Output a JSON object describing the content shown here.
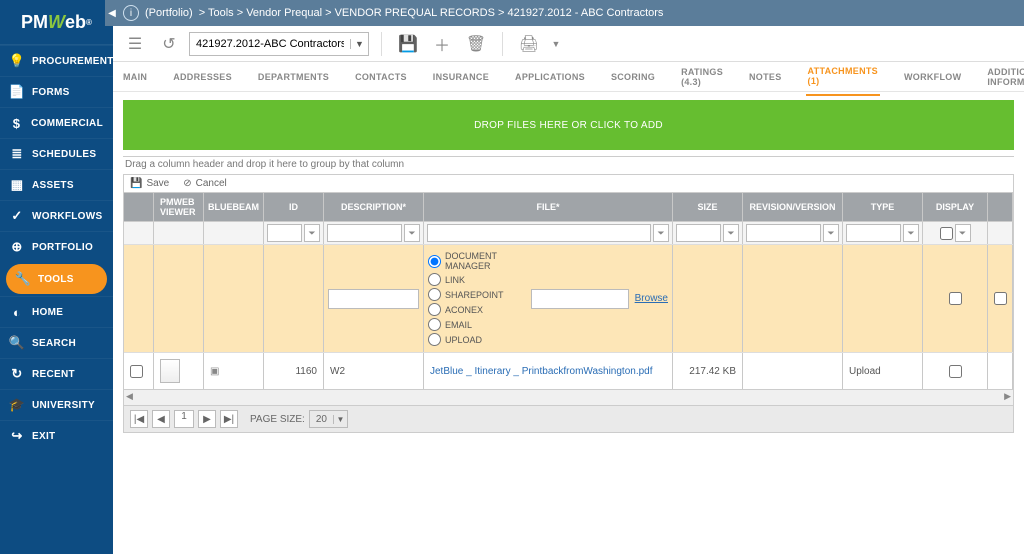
{
  "logo": {
    "pm": "PM",
    "w": "W",
    "eb": "eb",
    "reg": "®"
  },
  "sidebar": [
    {
      "icon": "💡",
      "label": "PROCUREMENT"
    },
    {
      "icon": "📄",
      "label": "FORMS"
    },
    {
      "icon": "$",
      "label": "COMMERCIAL"
    },
    {
      "icon": "≣",
      "label": "SCHEDULES"
    },
    {
      "icon": "▦",
      "label": "ASSETS"
    },
    {
      "icon": "✓",
      "label": "WORKFLOWS"
    },
    {
      "icon": "⊕",
      "label": "PORTFOLIO"
    },
    {
      "icon": "🔧",
      "label": "TOOLS",
      "active": true
    },
    {
      "icon": "◐",
      "label": "HOME"
    },
    {
      "icon": "🔍",
      "label": "SEARCH"
    },
    {
      "icon": "↻",
      "label": "RECENT"
    },
    {
      "icon": "🎓",
      "label": "UNIVERSITY"
    },
    {
      "icon": "↪",
      "label": "EXIT"
    }
  ],
  "breadcrumb": {
    "root": "(Portfolio)",
    "parts": [
      "Tools",
      "Vendor Prequal",
      "VENDOR PREQUAL RECORDS",
      "421927.2012 - ABC Contractors"
    ]
  },
  "record_select": "421927.2012-ABC Contractors",
  "tabs": [
    "MAIN",
    "ADDRESSES",
    "DEPARTMENTS",
    "CONTACTS",
    "INSURANCE",
    "APPLICATIONS",
    "SCORING",
    "RATINGS (4.3)",
    "NOTES",
    "ATTACHMENTS (1)",
    "WORKFLOW",
    "ADDITIONAL INFORMATION"
  ],
  "active_tab": "ATTACHMENTS (1)",
  "dropzone": "DROP FILES HERE OR CLICK TO ADD",
  "group_hint": "Drag a column header and drop it here to group by that column",
  "gridtool": {
    "save": "Save",
    "cancel": "Cancel"
  },
  "columns": {
    "pv": "PMWEB VIEWER",
    "bb": "BLUEBEAM",
    "id": "ID",
    "desc": "DESCRIPTION*",
    "file": "FILE*",
    "size": "SIZE",
    "rev": "REVISION/VERSION",
    "type": "TYPE",
    "disp": "DISPLAY"
  },
  "file_sources": [
    "DOCUMENT MANAGER",
    "LINK",
    "SHAREPOINT",
    "ACONEX",
    "EMAIL",
    "UPLOAD"
  ],
  "browse": "Browse",
  "row": {
    "id": "1160",
    "desc": "W2",
    "file": "JetBlue _ Itinerary _ PrintbackfromWashington.pdf",
    "size": "217.42 KB",
    "type": "Upload"
  },
  "pager": {
    "label": "PAGE SIZE:",
    "size": "20"
  }
}
